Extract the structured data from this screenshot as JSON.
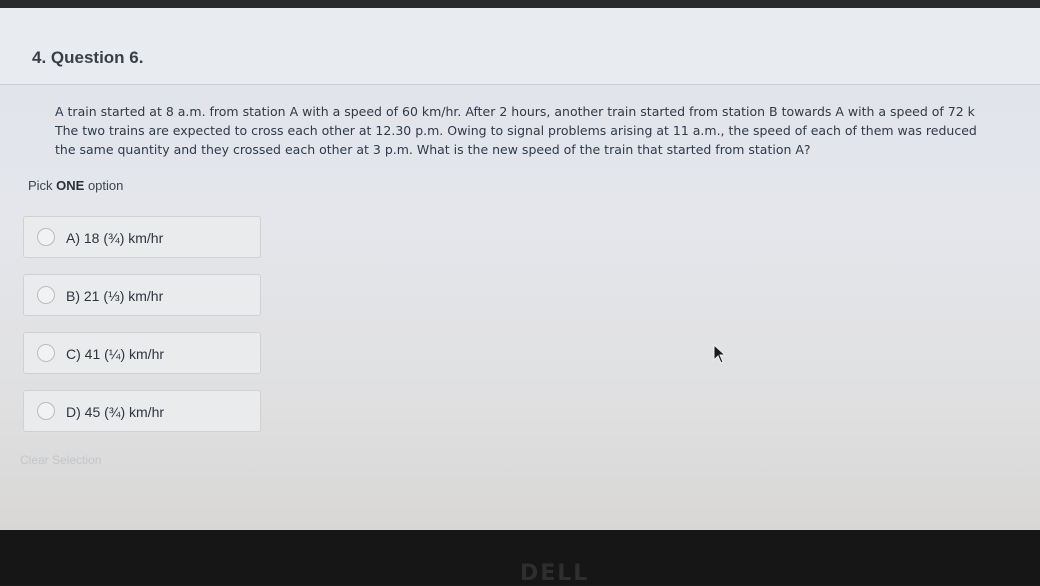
{
  "question": {
    "title": "4. Question 6.",
    "lines": [
      "A train started at 8 a.m. from station A with a speed of 60 km/hr. After 2 hours, another train started from station B towards A with a speed of 72 k",
      "The two trains are expected to cross each other at 12.30 p.m. Owing to signal problems arising at 11 a.m., the speed of each of them was reduced",
      "the same quantity and they crossed each other at 3 p.m. What is the new speed of the train that started from station A?"
    ]
  },
  "instruction": {
    "prefix": "Pick ",
    "emphasis": "ONE",
    "suffix": " option"
  },
  "options": [
    {
      "label": "A) 18 (¾) km/hr"
    },
    {
      "label": "B) 21 (⅓) km/hr"
    },
    {
      "label": "C) 41 (¼) km/hr"
    },
    {
      "label": "D) 45 (¾) km/hr"
    }
  ],
  "clear_selection_label": "Clear Selection",
  "bezel_logo": "DELL"
}
